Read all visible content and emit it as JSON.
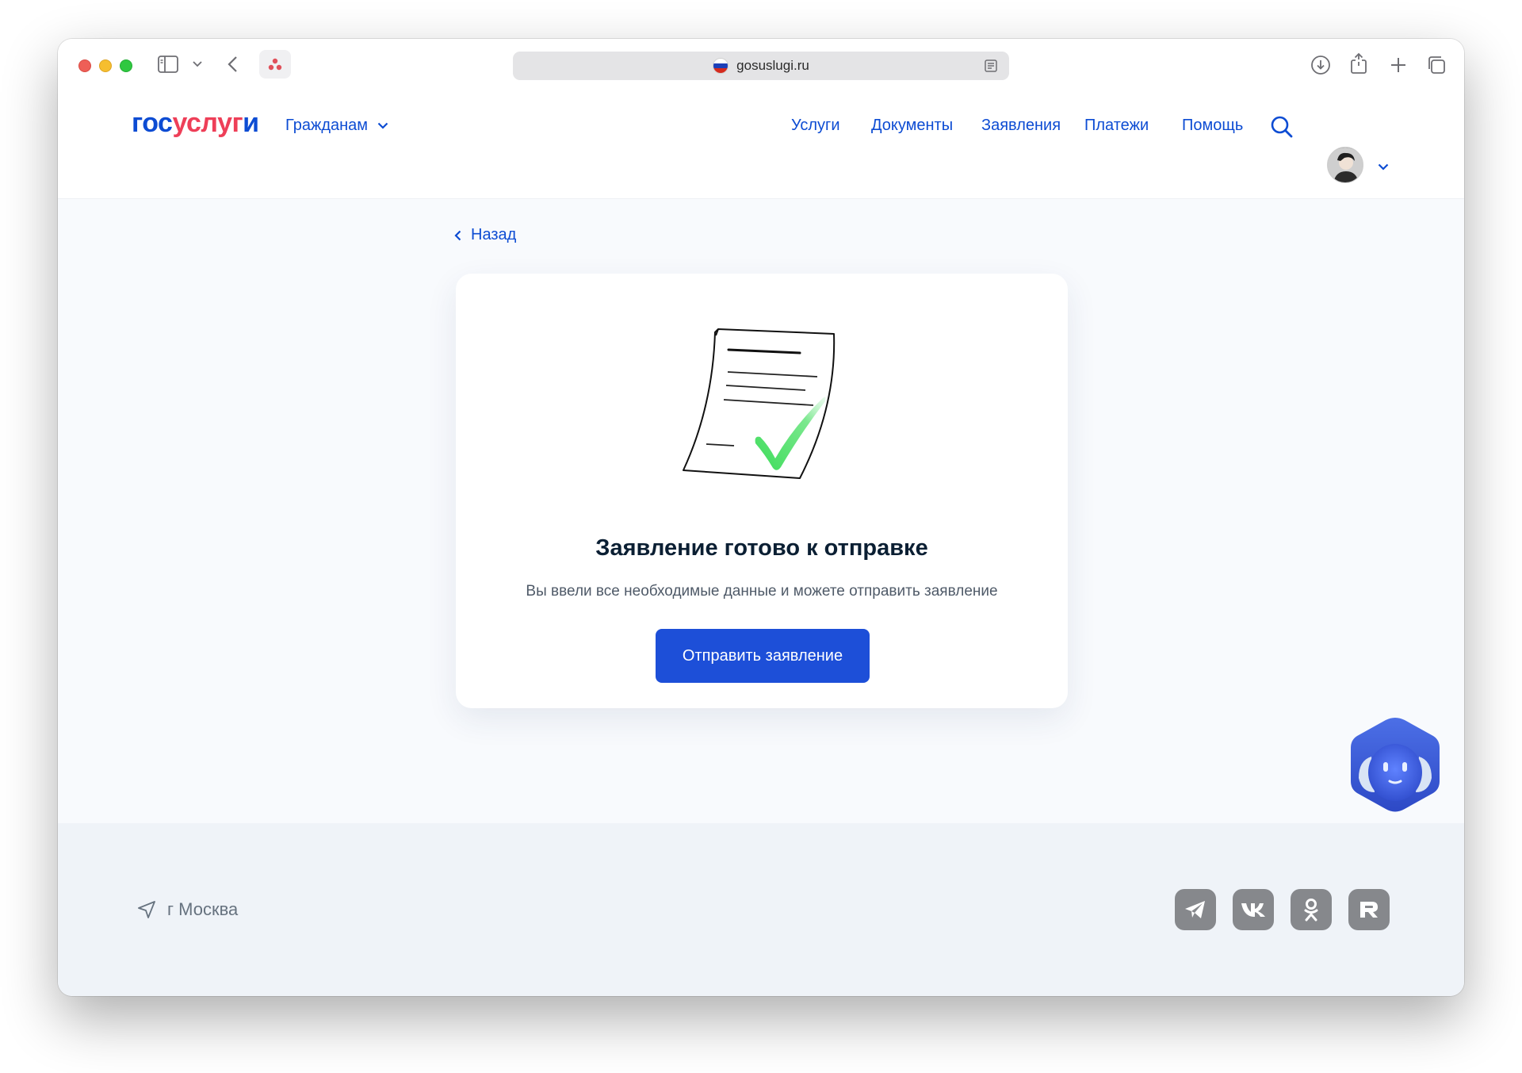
{
  "browser": {
    "url": "gosuslugi.ru",
    "icons": [
      "sidebar-icon",
      "chevron-down-icon",
      "back-arrow-icon",
      "extension-icon",
      "reader-icon",
      "download-icon",
      "share-icon",
      "new-tab-icon",
      "tabs-overview-icon"
    ]
  },
  "header": {
    "logo": {
      "part1": "гос",
      "part2": "услуг",
      "part3": "и"
    },
    "audience": "Гражданам",
    "nav": [
      "Услуги",
      "Документы",
      "Заявления",
      "Платежи",
      "Помощь"
    ],
    "icons": [
      "search-icon",
      "avatar",
      "chevron-down-icon"
    ]
  },
  "main": {
    "back": "Назад",
    "card": {
      "title": "Заявление готово к отправке",
      "subtitle": "Вы ввели все необходимые данные и можете отправить заявление",
      "button": "Отправить заявление"
    }
  },
  "footer": {
    "location": "г Москва",
    "social": [
      "telegram-icon",
      "vk-icon",
      "odnoklassniki-icon",
      "rutube-icon"
    ]
  },
  "colors": {
    "brand_blue": "#0d4cd3",
    "brand_red": "#ee3f58",
    "button_blue": "#1d4fd8",
    "page_bg": "#f8fafd",
    "footer_bg": "#eff3f8",
    "social_gray": "#86888c"
  }
}
